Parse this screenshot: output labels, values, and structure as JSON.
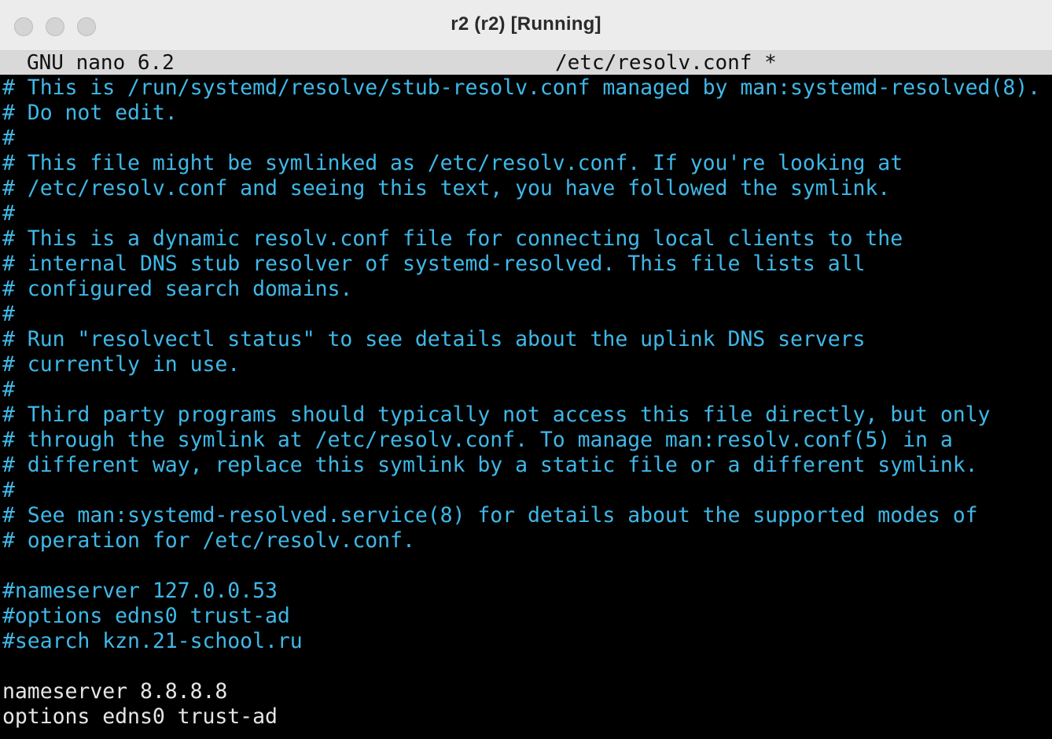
{
  "window": {
    "title": "r2 (r2) [Running]"
  },
  "nano": {
    "version": "GNU nano 6.2",
    "filename": "/etc/resolv.conf *"
  },
  "lines": [
    "# This is /run/systemd/resolve/stub-resolv.conf managed by man:systemd-resolved(8).",
    "# Do not edit.",
    "#",
    "# This file might be symlinked as /etc/resolv.conf. If you're looking at",
    "# /etc/resolv.conf and seeing this text, you have followed the symlink.",
    "#",
    "# This is a dynamic resolv.conf file for connecting local clients to the",
    "# internal DNS stub resolver of systemd-resolved. This file lists all",
    "# configured search domains.",
    "#",
    "# Run \"resolvectl status\" to see details about the uplink DNS servers",
    "# currently in use.",
    "#",
    "# Third party programs should typically not access this file directly, but only",
    "# through the symlink at /etc/resolv.conf. To manage man:resolv.conf(5) in a",
    "# different way, replace this symlink by a static file or a different symlink.",
    "#",
    "# See man:systemd-resolved.service(8) for details about the supported modes of",
    "# operation for /etc/resolv.conf.",
    "",
    "#nameserver 127.0.0.53",
    "#options edns0 trust-ad",
    "#search kzn.21-school.ru",
    "",
    "nameserver 8.8.8.8",
    "options edns0 trust-ad"
  ],
  "colors": {
    "comment": "#3fb8e8",
    "text": "#e6e6e6",
    "background": "#000000",
    "header_bar": "#d9d9d9"
  }
}
